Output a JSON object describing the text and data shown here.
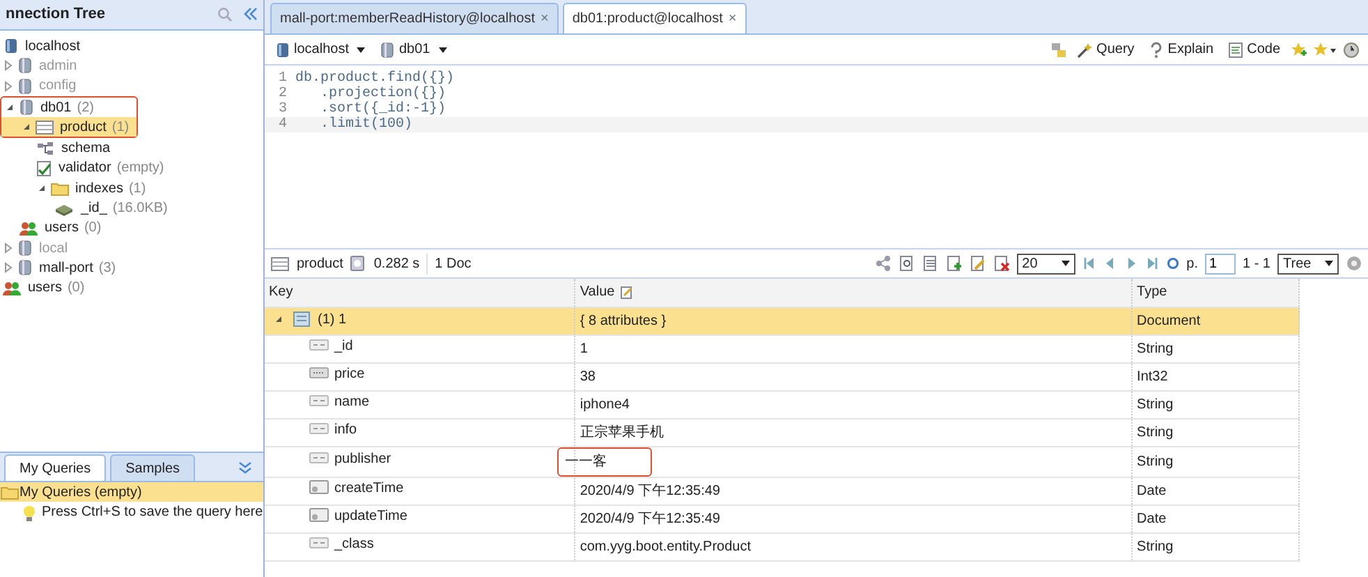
{
  "connection_tree": {
    "title": "nnection Tree",
    "nodes": [
      {
        "label": "localhost",
        "kind": "server",
        "dimmed": false,
        "children": [
          {
            "label": "admin",
            "kind": "db",
            "expanded": false,
            "dimmed": true
          },
          {
            "label": "config",
            "kind": "db",
            "expanded": false,
            "dimmed": true
          },
          {
            "label": "db01",
            "count": "(2)",
            "kind": "db",
            "expanded": true,
            "dimmed": false,
            "annotated": true,
            "children": [
              {
                "label": "product",
                "count": "(1)",
                "kind": "collection",
                "expanded": true,
                "selected": true,
                "dimmed": false,
                "children": [
                  {
                    "label": "schema",
                    "kind": "schema",
                    "dimmed": false
                  },
                  {
                    "label": "validator",
                    "count": "(empty)",
                    "kind": "validator",
                    "dimmed": false
                  },
                  {
                    "label": "indexes",
                    "count": "(1)",
                    "kind": "folder",
                    "expanded": true,
                    "dimmed": false,
                    "children": [
                      {
                        "label": "_id_",
                        "count": "(16.0KB)",
                        "kind": "index",
                        "dimmed": false
                      }
                    ]
                  }
                ]
              },
              {
                "label": "users",
                "count": "(0)",
                "kind": "users",
                "dimmed": false
              }
            ]
          },
          {
            "label": "local",
            "kind": "db",
            "expanded": false,
            "dimmed": true
          },
          {
            "label": "mall-port",
            "count": "(3)",
            "kind": "db",
            "expanded": false,
            "dimmed": false
          },
          {
            "label": "users",
            "count": "(0)",
            "kind": "users",
            "dimmed": false
          }
        ]
      }
    ]
  },
  "queries_panel": {
    "tabs": [
      {
        "label": "My Queries",
        "selected": true
      },
      {
        "label": "Samples",
        "selected": false
      }
    ],
    "folder": {
      "label": "My Queries (empty)",
      "selected": true
    },
    "hint": "Press Ctrl+S to save the query here"
  },
  "editor_tabs": [
    {
      "label": "mall-port:memberReadHistory@localhost",
      "close": "×",
      "selected": false
    },
    {
      "label": "db01:product@localhost",
      "close": "×",
      "selected": true
    }
  ],
  "toolbar": {
    "server": "localhost",
    "database": "db01",
    "buttons": [
      {
        "label": "Query",
        "kind": "query"
      },
      {
        "label": "Explain",
        "kind": "explain"
      },
      {
        "label": "Code",
        "kind": "code"
      }
    ]
  },
  "code_lines": [
    {
      "number": "1",
      "text": "db.product.find({})",
      "current": false
    },
    {
      "number": "2",
      "text": "   .projection({})",
      "current": false
    },
    {
      "number": "3",
      "text": "   .sort({_id:-1})",
      "current": false
    },
    {
      "number": "4",
      "text": "   .limit(100)",
      "current": true
    }
  ],
  "results_toolbar": {
    "collection": "product",
    "time": "0.282 s",
    "count": "1 Doc",
    "page_size": "20",
    "page_label": "p.",
    "page": "1",
    "range": "1 - 1",
    "view": "Tree"
  },
  "table": {
    "columns": [
      "Key",
      "Value",
      "Type"
    ],
    "rows": [
      {
        "key": "(1) 1",
        "value": "{ 8 attributes }",
        "type": "Document",
        "kind": "document",
        "selected": true,
        "expanded": true,
        "children": [
          {
            "key": "_id",
            "value": "1",
            "type": "String",
            "kind": "string"
          },
          {
            "key": "price",
            "value": "38",
            "type": "Int32",
            "kind": "number"
          },
          {
            "key": "name",
            "value": "iphone4",
            "type": "String",
            "kind": "string"
          },
          {
            "key": "info",
            "value": "正宗苹果手机",
            "type": "String",
            "kind": "string"
          },
          {
            "key": "publisher",
            "value": "一一客",
            "type": "String",
            "kind": "string",
            "annotated": true
          },
          {
            "key": "createTime",
            "value": "2020/4/9 下午12:35:49",
            "type": "Date",
            "kind": "date"
          },
          {
            "key": "updateTime",
            "value": "2020/4/9 下午12:35:49",
            "type": "Date",
            "kind": "date"
          },
          {
            "key": "_class",
            "value": "com.yyg.boot.entity.Product",
            "type": "String",
            "kind": "string"
          }
        ]
      }
    ]
  }
}
